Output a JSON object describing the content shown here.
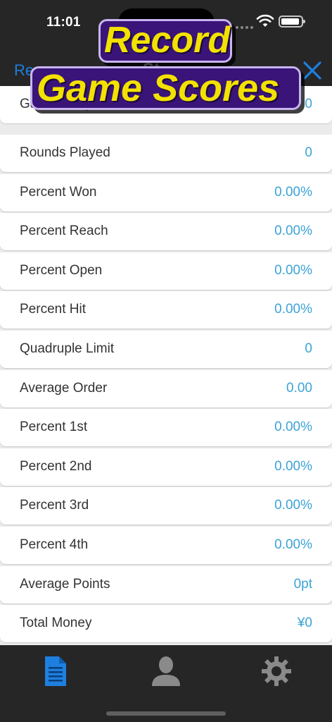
{
  "status_bar": {
    "time": "11:01"
  },
  "nav": {
    "left_label": "Re",
    "title": "St"
  },
  "promo": {
    "line1": "Record",
    "line2": "Game Scores"
  },
  "stats": [
    {
      "label": "Games Played",
      "value": "0"
    },
    {
      "label": "Rounds Played",
      "value": "0"
    },
    {
      "label": "Percent Won",
      "value": "0.00%"
    },
    {
      "label": "Percent Reach",
      "value": "0.00%"
    },
    {
      "label": "Percent Open",
      "value": "0.00%"
    },
    {
      "label": "Percent Hit",
      "value": "0.00%"
    },
    {
      "label": "Quadruple Limit",
      "value": "0"
    },
    {
      "label": "Average Order",
      "value": "0.00"
    },
    {
      "label": "Percent 1st",
      "value": "0.00%"
    },
    {
      "label": "Percent 2nd",
      "value": "0.00%"
    },
    {
      "label": "Percent 3rd",
      "value": "0.00%"
    },
    {
      "label": "Percent 4th",
      "value": "0.00%"
    },
    {
      "label": "Average Points",
      "value": "0pt"
    },
    {
      "label": "Total Money",
      "value": "¥0"
    }
  ],
  "tabs": [
    {
      "icon": "document-icon",
      "active": true
    },
    {
      "icon": "person-icon",
      "active": false
    },
    {
      "icon": "gear-icon",
      "active": false
    }
  ],
  "colors": {
    "accent": "#1e7fe0",
    "value_text": "#3ba3d6",
    "bar_background": "#262626",
    "promo_text": "#f3e200",
    "promo_box": "#3a1478"
  }
}
